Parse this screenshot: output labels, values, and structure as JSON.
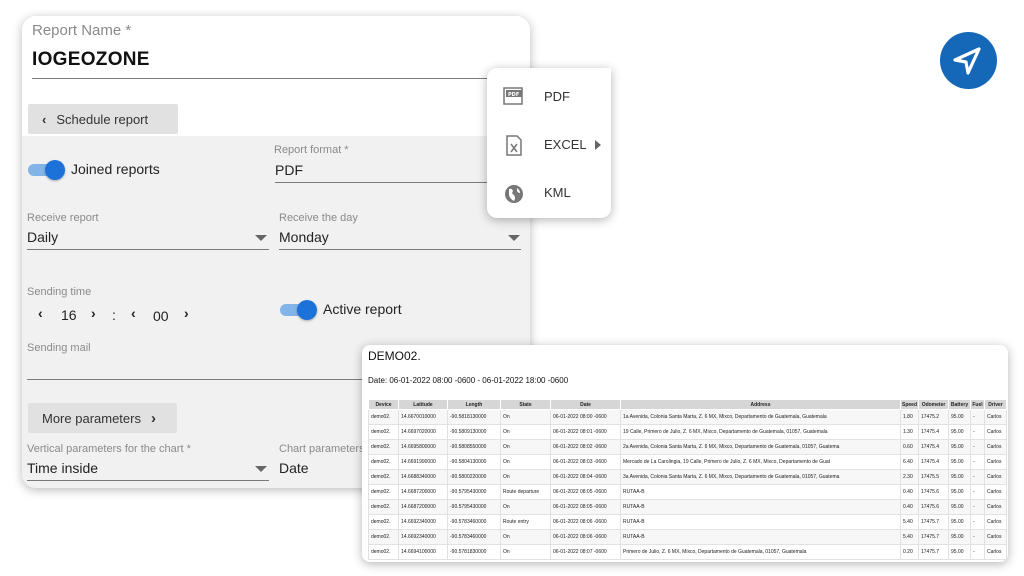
{
  "report_name": {
    "label": "Report Name *",
    "value": "IOGEOZONE"
  },
  "schedule_button": {
    "label": "Schedule report"
  },
  "joined_reports": {
    "label": "Joined reports",
    "enabled": true
  },
  "report_format": {
    "label": "Report format *",
    "value": "PDF"
  },
  "receive_report": {
    "label": "Receive report",
    "value": "Daily"
  },
  "receive_day": {
    "label": "Receive the day",
    "value": "Monday"
  },
  "sending_time": {
    "label": "Sending time",
    "hour": "16",
    "separator": ":",
    "minute": "00"
  },
  "active_report": {
    "label": "Active report",
    "enabled": true
  },
  "sending_mail": {
    "label": "Sending mail",
    "value": ""
  },
  "more_parameters": {
    "label": "More parameters"
  },
  "vertical_params": {
    "label": "Vertical parameters for the chart *",
    "value": "Time inside"
  },
  "chart_params": {
    "label": "Chart parameters",
    "value": "Date"
  },
  "format_menu": {
    "items": [
      {
        "label": "PDF",
        "icon": "pdf-file-icon"
      },
      {
        "label": "EXCEL",
        "icon": "excel-file-icon",
        "has_submenu": true
      },
      {
        "label": "KML",
        "icon": "globe-icon"
      }
    ]
  },
  "send_button": {
    "icon": "send-arrow-icon",
    "color": "#1568b7"
  },
  "report_preview": {
    "title": "DEMO02.",
    "date_range": "Date: 06-01-2022 08:00 -0600 - 06-01-2022 18:00 -0600",
    "columns": [
      "Device",
      "Latitude",
      "Length",
      "State",
      "Date",
      "Address",
      "Speed",
      "Odometer",
      "Battery",
      "Fuel",
      "Driver"
    ],
    "rows": [
      [
        "demo02.",
        "14.6670010000",
        "-90.5818130000",
        "On",
        "06-01-2022 08:00 -0600",
        "1a Avenida, Colonia Santa Marta, Z. 6 MX, Mixco, Departamento de Guatemala, Guatemala",
        "1.80",
        "17475.2",
        "95.00",
        "-",
        "Carlos"
      ],
      [
        "demo02.",
        "14.6697020000",
        "-90.5809130000",
        "On",
        "06-01-2022 08:01 -0600",
        "19 Calle, Primero de Julio, Z. 6 MX, Mixco, Departamento de Guatemala, 01057, Guatemala",
        "1.30",
        "17475.4",
        "95.00",
        "-",
        "Carlos"
      ],
      [
        "demo02.",
        "14.6695800000",
        "-90.5808550000",
        "On",
        "06-01-2022 08:02 -0600",
        "2a Avenida, Colonia Santa Marta, Z. 6 MX, Mixco, Departamento de Guatemala, 01057, Guatema",
        "0.60",
        "17475.4",
        "95.00",
        "-",
        "Carlos"
      ],
      [
        "demo02.",
        "14.6691990000",
        "-90.5804130000",
        "On",
        "06-01-2022 08:03 -0600",
        "Mercado de La Carolingia, 19 Calle, Primero de Julio, Z. 6 MX, Mixco, Departamento de Guat",
        "6.40",
        "17475.4",
        "95.00",
        "-",
        "Carlos"
      ],
      [
        "demo02.",
        "14.6688340000",
        "-90.5800220000",
        "On",
        "06-01-2022 08:04 -0600",
        "3a Avenida, Colonia Santa Marta, Z. 6 MX, Mixco, Departamento de Guatemala, 01057, Guatema",
        "2.30",
        "17475.5",
        "95.00",
        "-",
        "Carlos"
      ],
      [
        "demo02.",
        "14.6687200000",
        "-90.5795430000",
        "Route departure",
        "06-01-2022 08:05 -0600",
        "RUTAA-B",
        "0.40",
        "17475.6",
        "95.00",
        "-",
        "Carlos"
      ],
      [
        "demo02.",
        "14.6687200000",
        "-90.5795430000",
        "On",
        "06-01-2022 08:05 -0600",
        "RUTAA-B",
        "0.40",
        "17475.6",
        "95.00",
        "-",
        "Carlos"
      ],
      [
        "demo02.",
        "14.6692340000",
        "-90.5783460000",
        "Route entry",
        "06-01-2022 08:06 -0600",
        "RUTAA-B",
        "5.40",
        "17475.7",
        "95.00",
        "-",
        "Carlos"
      ],
      [
        "demo02.",
        "14.6692340000",
        "-90.5783460000",
        "On",
        "06-01-2022 08:06 -0600",
        "RUTAA-B",
        "5.40",
        "17475.7",
        "95.00",
        "-",
        "Carlos"
      ],
      [
        "demo02.",
        "14.6694100000",
        "-90.5781830000",
        "On",
        "06-01-2022 08:07 -0600",
        "Primero de Julio, Z. 6 MX, Mixco, Departamento de Guatemala, 01057, Guatemala",
        "0.20",
        "17475.7",
        "95.00",
        "-",
        "Carlos"
      ]
    ]
  }
}
